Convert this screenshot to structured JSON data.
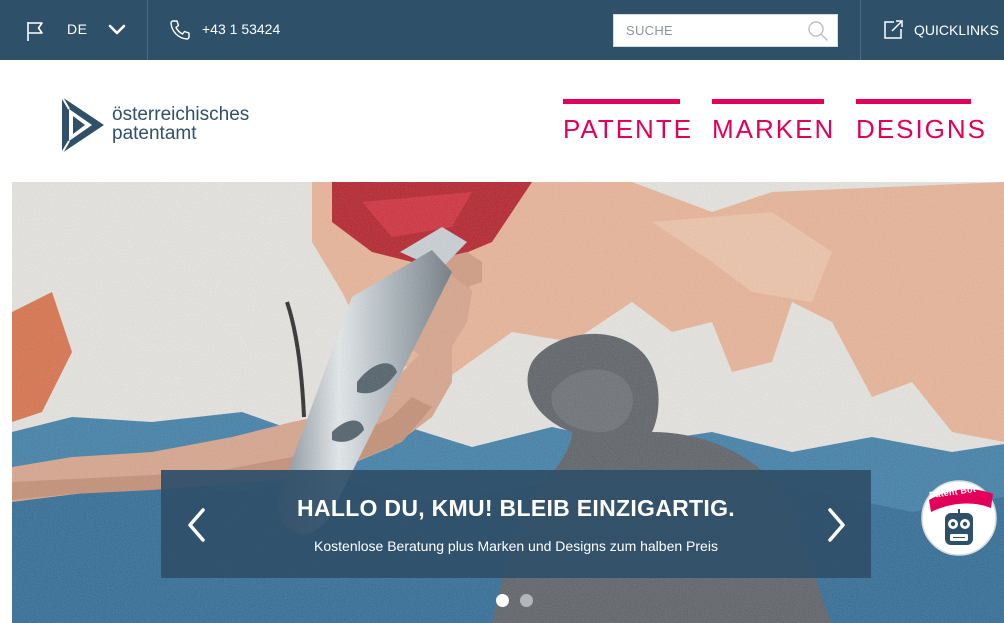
{
  "topbar": {
    "language": "DE",
    "phone": "+43 1 53424",
    "search_placeholder": "SUCHE",
    "quicklinks_label": "QUICKLINKS"
  },
  "logo": {
    "line1": "österreichisches",
    "line2": "patentamt"
  },
  "nav": [
    {
      "label": "PATENTE"
    },
    {
      "label": "MARKEN"
    },
    {
      "label": "DESIGNS"
    }
  ],
  "hero": {
    "title": "HALLO DU, KMU! BLEIB EINZIGARTIG.",
    "subtitle": "Kostenlose Beratung plus Marken und Designs zum halben Preis",
    "slide_count": 2,
    "active_slide": 1
  },
  "bot": {
    "label": "Patent Bot"
  },
  "colors": {
    "topbar": "#2f5069",
    "accent": "#e2005a",
    "caption_bg": "#2f5069"
  },
  "icons": {
    "language": "flag-icon",
    "dropdown": "chevron-down-icon",
    "phone": "phone-icon",
    "search": "search-icon",
    "quicklinks": "external-link-icon",
    "prev": "chevron-left-icon",
    "next": "chevron-right-icon"
  }
}
